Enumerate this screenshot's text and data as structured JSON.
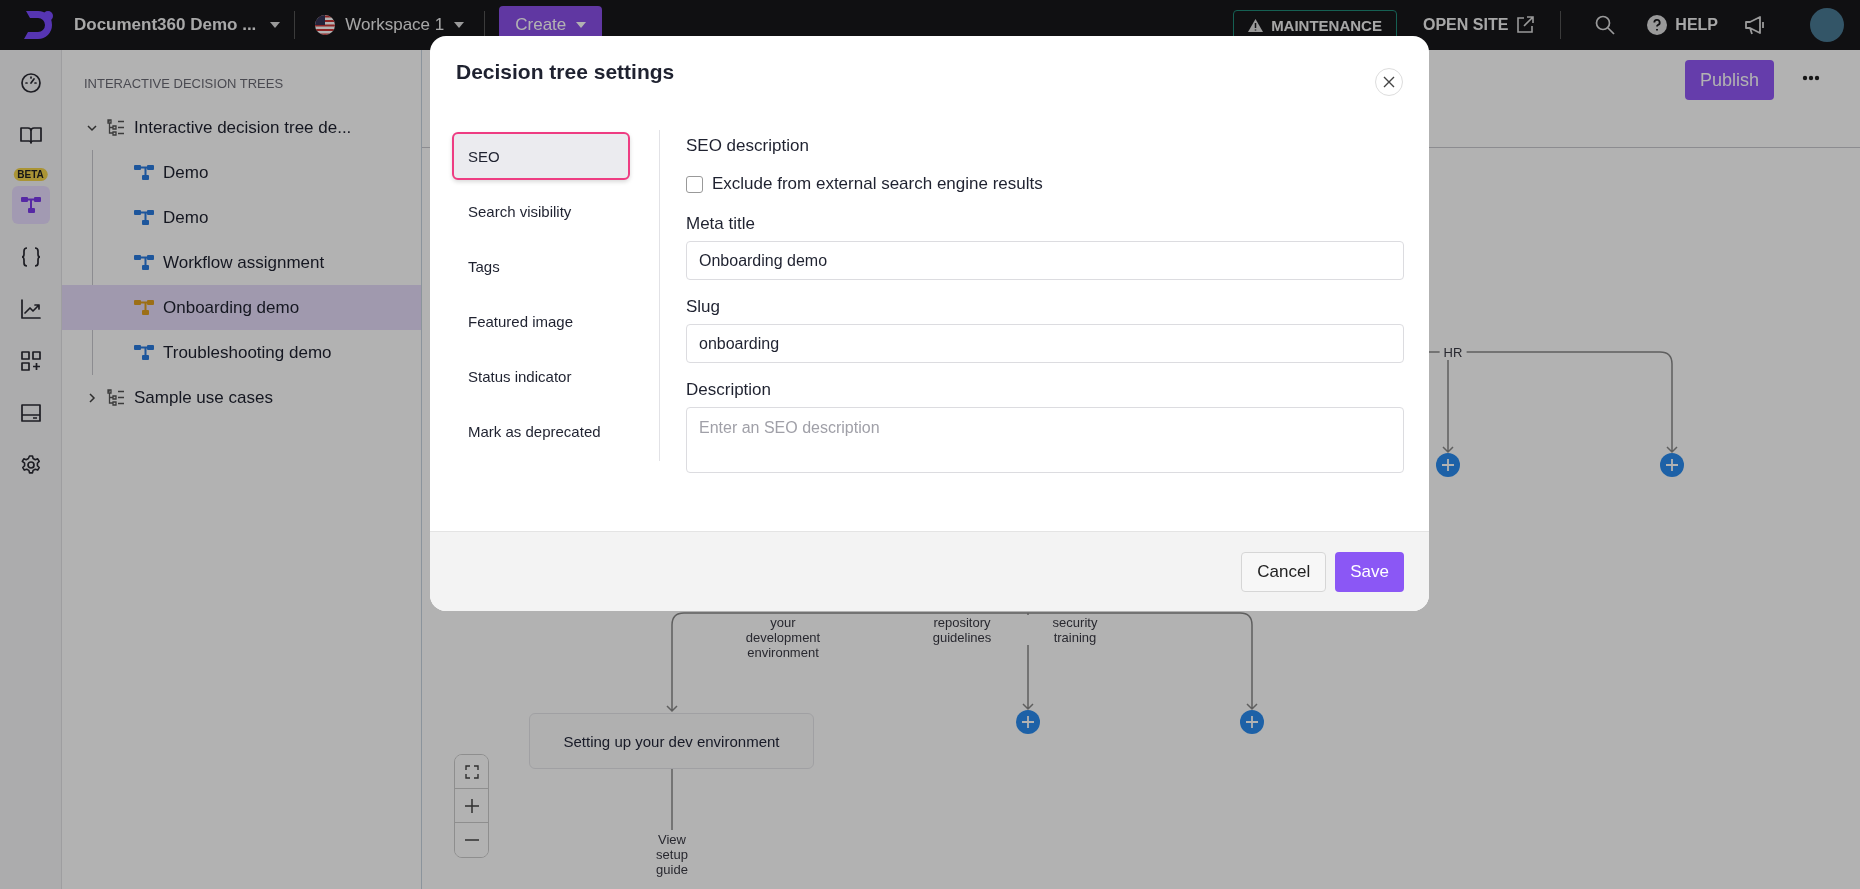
{
  "topbar": {
    "project": "Document360 Demo ...",
    "workspace": "Workspace 1",
    "create_button": "Create",
    "maintenance": "MAINTENANCE",
    "open_site": "OPEN SITE",
    "help": "HELP"
  },
  "rail": [
    {
      "kind": "dashboard",
      "selected": false
    },
    {
      "kind": "docs",
      "selected": false
    },
    {
      "kind": "decision-tree",
      "selected": true,
      "badge": "BETA"
    },
    {
      "kind": "api",
      "selected": false
    },
    {
      "kind": "analytics",
      "selected": false
    },
    {
      "kind": "apps",
      "selected": false
    },
    {
      "kind": "widget",
      "selected": false
    },
    {
      "kind": "settings",
      "selected": false
    }
  ],
  "sidebar": {
    "heading": "INTERACTIVE DECISION TREES",
    "tree": [
      {
        "label": "Interactive decision tree de...",
        "expanded": true,
        "children": [
          {
            "label": "Demo",
            "selected": false
          },
          {
            "label": "Demo",
            "selected": false
          },
          {
            "label": "Workflow assignment",
            "selected": false
          },
          {
            "label": "Onboarding demo",
            "selected": true
          },
          {
            "label": "Troubleshooting demo",
            "selected": false
          }
        ]
      },
      {
        "label": "Sample use cases",
        "expanded": false
      }
    ]
  },
  "canvas": {
    "publish_button": "Publish",
    "edge_labels": [
      "HR",
      "your development environment",
      "repository guidelines",
      "security training",
      "View setup guide"
    ],
    "nodes": [
      {
        "label": "Setting up your dev environment"
      }
    ]
  },
  "dialog": {
    "title": "Decision tree settings",
    "nav": [
      {
        "label": "SEO",
        "selected": true
      },
      {
        "label": "Search visibility",
        "selected": false
      },
      {
        "label": "Tags",
        "selected": false
      },
      {
        "label": "Featured image",
        "selected": false
      },
      {
        "label": "Status indicator",
        "selected": false
      },
      {
        "label": "Mark as deprecated",
        "selected": false
      }
    ],
    "section_title": "SEO description",
    "exclude": {
      "label": "Exclude from external search engine results",
      "checked": false
    },
    "fields": [
      {
        "label": "Meta title",
        "value": "Onboarding demo",
        "kind": "input"
      },
      {
        "label": "Slug",
        "value": "onboarding",
        "kind": "input"
      },
      {
        "label": "Description",
        "placeholder": "Enter an SEO description",
        "kind": "textarea"
      }
    ],
    "cancel_button": "Cancel",
    "save_button": "Save"
  }
}
